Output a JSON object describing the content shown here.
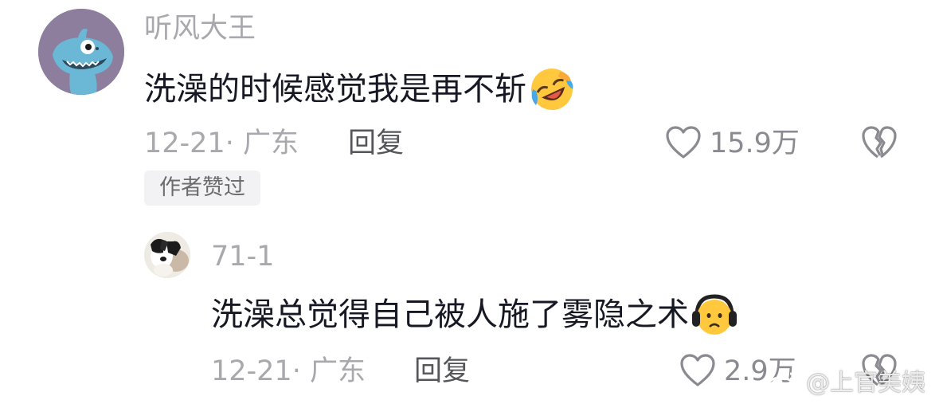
{
  "comment": {
    "username": "听风大王",
    "text": "洗澡的时候感觉我是再不斩",
    "emoji": "rofl-emoji",
    "date_location": "12-21· 广东",
    "reply_label": "回复",
    "likes": "15.9万",
    "author_badge": "作者赞过"
  },
  "reply": {
    "username": "71-1",
    "text": "洗澡总觉得自己被人施了雾隐之术",
    "emoji": "headphones-worried-emoji",
    "date_location": "12-21· 广东",
    "reply_label": "回复",
    "likes": "2.9万"
  },
  "watermark": {
    "text": "@上官美姨",
    "icon": "weibo-icon"
  },
  "colors": {
    "username": "#a9a9ad",
    "text": "#161823",
    "meta": "#a9a9ad",
    "reply": "#55565c",
    "icon": "#8a8a90"
  }
}
